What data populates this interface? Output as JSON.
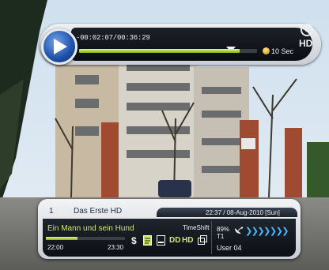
{
  "playback": {
    "time_display": "-00:02:07/00:36:29",
    "progress_fraction": 0.9,
    "skip_label": "10 Sec",
    "play_icon": "play-icon",
    "marker_icon": "position-marker-icon"
  },
  "channel_badge": {
    "logo_text": "1",
    "hd_text": "HD"
  },
  "banner": {
    "channel_number": "1",
    "channel_name": "Das Erste HD",
    "datetime": "22:37 / 08-Aug-2010 [Sun]",
    "program_title": "Ein Mann und sein Hund",
    "timeshift_label": "TimeShift",
    "start_time": "22:00",
    "end_time": "23:30",
    "event_progress_fraction": 0.4,
    "icons": [
      "dollar-icon",
      "teletext-icon",
      "subtitle-icon",
      "dolby-icon",
      "hd-icon",
      "aspect-icon"
    ],
    "hd_icon_text": "HD",
    "signal_percent": "89%",
    "satellite_label": "T1",
    "user_label": "User 04"
  },
  "colors": {
    "accent_green": "#cde86a",
    "accent_blue": "#4fb6ff",
    "bar_dark": "#0a0d12"
  }
}
